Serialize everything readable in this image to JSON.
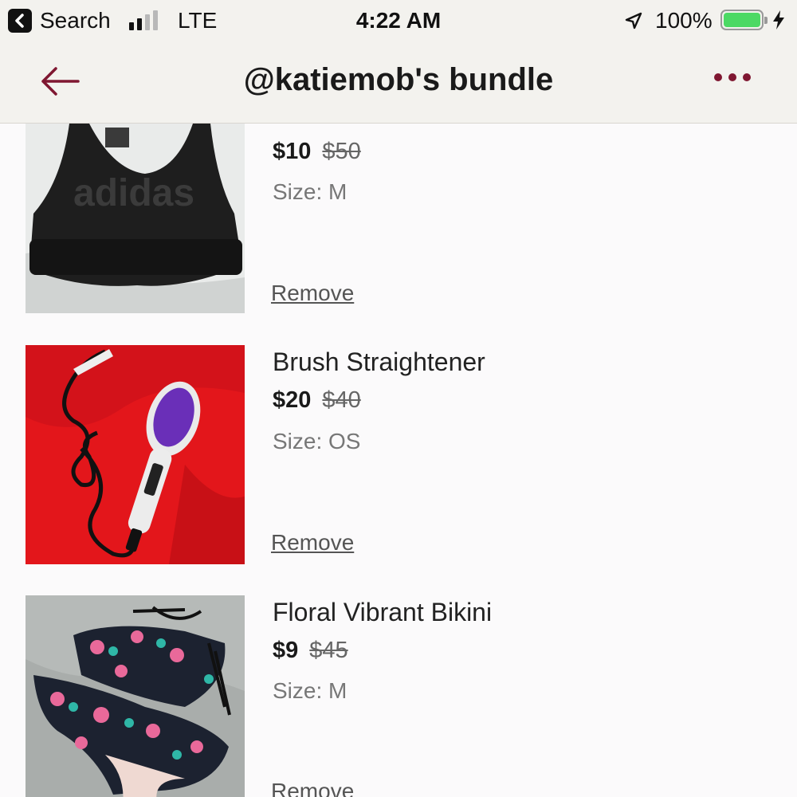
{
  "status_bar": {
    "back_app_label": "Search",
    "carrier": "LTE",
    "time": "4:22 AM",
    "battery_percent_label": "100%",
    "battery_level": 1.0,
    "signal_bars_active": 2,
    "signal_bars_total": 4
  },
  "nav": {
    "title": "@katiemob's bundle",
    "back_icon": "arrow-left-icon",
    "more_icon": "more-dots-icon",
    "accent_color": "#7f1731"
  },
  "items": [
    {
      "title": "",
      "price": "$10",
      "original_price": "$50",
      "size": "Size: M",
      "remove_label": "Remove"
    },
    {
      "title": "Brush Straightener",
      "price": "$20",
      "original_price": "$40",
      "size": "Size: OS",
      "remove_label": "Remove"
    },
    {
      "title": "Floral Vibrant Bikini",
      "price": "$9",
      "original_price": "$45",
      "size": "Size: M",
      "remove_label": "Remove"
    }
  ]
}
